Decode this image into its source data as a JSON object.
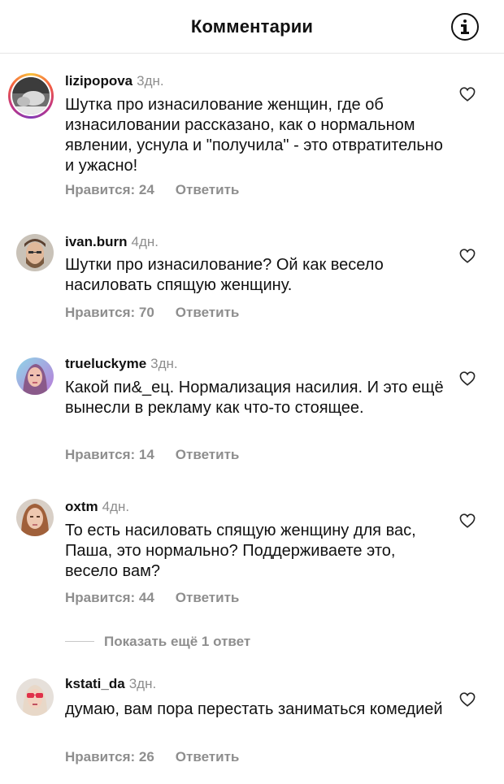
{
  "header": {
    "title": "Комментарии",
    "info_icon": "info-icon"
  },
  "comments": [
    {
      "username": "lizipopova",
      "time": "3дн.",
      "text": "Шутка про изнасилование женщин, где об изнасиловании рассказано, как о нормальном явлении, уснула и \"получила\" - это отвратительно и ужасно!",
      "likes": "Нравится: 24",
      "reply": "Ответить",
      "has_story_ring": true
    },
    {
      "username": "ivan.burn",
      "time": "4дн.",
      "text": "Шутки про изнасилование? Ой как весело насиловать спящую женщину.",
      "likes": "Нравится: 70",
      "reply": "Ответить",
      "has_story_ring": false
    },
    {
      "username": "trueluckyme",
      "time": "3дн.",
      "text": "Какой пи&_ец. Нормализация насилия. И это ещё вынесли в рекламу как что-то стоящее.",
      "likes": "Нравится: 14",
      "reply": "Ответить",
      "has_story_ring": false
    },
    {
      "username": "oxtm",
      "time": "4дн.",
      "text": "То есть насиловать спящую женщину для вас, Паша, это нормально? Поддерживаете это, весело вам?",
      "likes": "Нравится: 44",
      "reply": "Ответить",
      "has_story_ring": false
    },
    {
      "username": "kstati_da",
      "time": "3дн.",
      "text": "думаю, вам пора перестать заниматься комедией",
      "likes": "Нравится: 26",
      "reply": "Ответить",
      "has_story_ring": false
    }
  ],
  "more_replies": "Показать ещё 1 ответ",
  "colors": {
    "text": "#111111",
    "secondary": "#8e8e8e",
    "divider": "#e6e6e6"
  }
}
